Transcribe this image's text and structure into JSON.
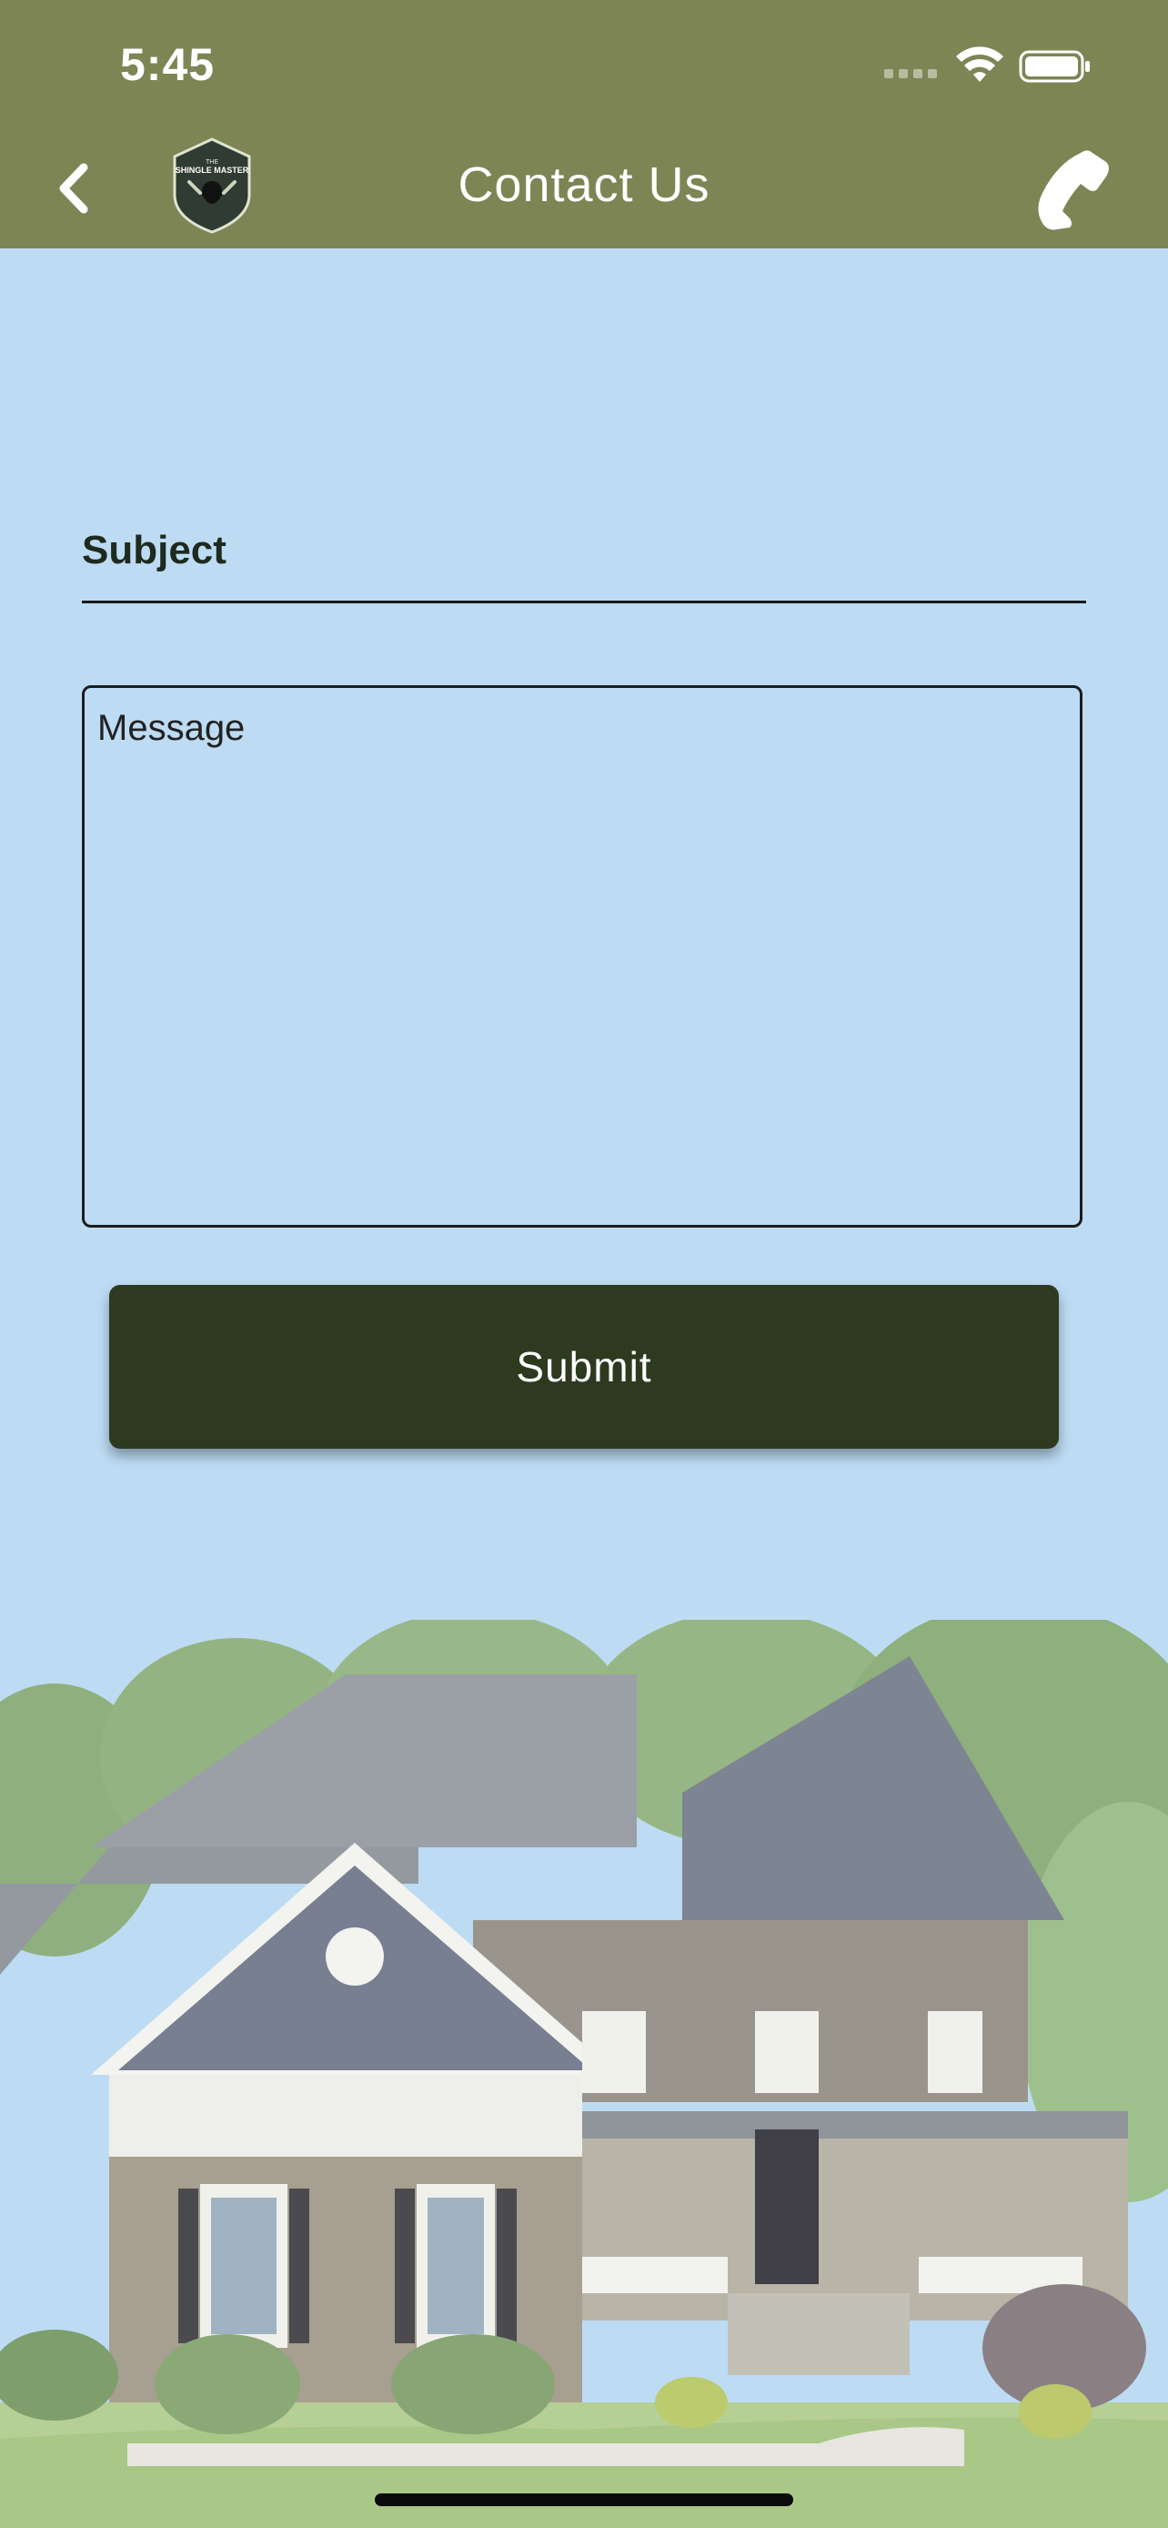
{
  "status_bar": {
    "time": "5:45"
  },
  "nav": {
    "title": "Contact Us",
    "logo_top_text": "THE",
    "logo_text": "SHINGLE MASTER",
    "back_icon": "chevron-left-icon",
    "phone_icon": "phone-icon"
  },
  "form": {
    "subject_label": "Subject",
    "message_placeholder": "Message",
    "submit_label": "Submit"
  },
  "colors": {
    "header": "#7d8555",
    "background": "#bddcf4",
    "button": "#2d3a1f"
  }
}
